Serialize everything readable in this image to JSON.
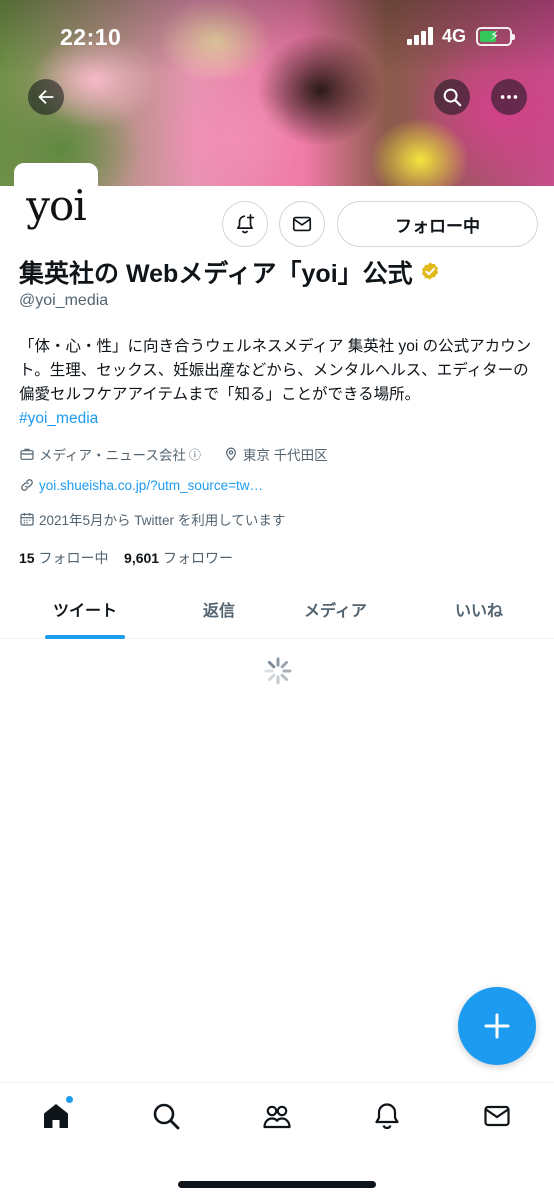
{
  "status_bar": {
    "time": "22:10",
    "network": "4G"
  },
  "colors": {
    "accent": "#1d9bf0",
    "text_primary": "#0f1419",
    "text_secondary": "#536471",
    "verified_badge": "#e2b719"
  },
  "header": {
    "back_icon": "arrow-left-icon",
    "search_icon": "search-icon",
    "more_icon": "more-dots-icon"
  },
  "profile": {
    "avatar_logo": "yoi",
    "display_name": "集英社の Webメディア「yoi」公式",
    "handle": "@yoi_media",
    "bio": "「体・心・性」に向き合うウェルネスメディア 集英社 yoi の公式アカウント。生理、セックス、妊娠出産などから、メンタルヘルス、エディターの偏愛セルフケアアイテムまで「知る」ことができる場所。",
    "hashtag": "#yoi_media",
    "category": "メディア・ニュース会社",
    "location": "東京 千代田区",
    "website": "yoi.shueisha.co.jp/?utm_source=tw…",
    "joined": "2021年5月から Twitter を利用しています",
    "following_count": "15",
    "following_label": "フォロー中",
    "followers_count": "9,601",
    "followers_label": "フォロワー"
  },
  "actions": {
    "notify_icon": "bell-plus-icon",
    "message_icon": "envelope-icon",
    "follow_label": "フォロー中"
  },
  "tabs": [
    {
      "label": "ツイート",
      "active": true
    },
    {
      "label": "返信",
      "active": false
    },
    {
      "label": "メディア",
      "active": false
    },
    {
      "label": "いいね",
      "active": false
    }
  ],
  "fab": {
    "icon": "plus-icon"
  },
  "bottom_nav": [
    {
      "icon": "home-icon",
      "badge": true
    },
    {
      "icon": "search-icon",
      "badge": false
    },
    {
      "icon": "communities-icon",
      "badge": false
    },
    {
      "icon": "bell-icon",
      "badge": false
    },
    {
      "icon": "envelope-icon",
      "badge": false
    }
  ]
}
